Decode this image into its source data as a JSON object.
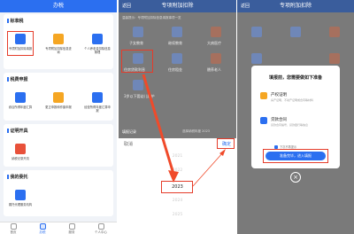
{
  "p1": {
    "title": "办税",
    "sec1": "标准税",
    "items1": [
      "专项附加扣除填报",
      "专项附加扣除信息查询",
      "个人养老金扣除信息管理"
    ],
    "sec2": "税费申报",
    "items2": [
      "综合所得年度汇算",
      "更正申报和作废申报",
      "经营所得年度汇算申报"
    ],
    "sec3": "证明开具",
    "items3": [
      "纳税记录开具"
    ],
    "sec4": "我的委托",
    "items4": [
      "委托代理服务机构"
    ],
    "tabs": [
      "首页",
      "办税",
      "服务",
      "个人中心"
    ]
  },
  "p2": {
    "back": "返回",
    "title": "专项附加扣除",
    "notice": "温馨提示：专项附加扣除信息填报事项一览",
    "row1": [
      "子女教育",
      "继续教育",
      "大病医疗"
    ],
    "row2": [
      "住房贷款利息",
      "住房租金",
      "赡养老人"
    ],
    "row3": "3岁以下婴幼儿照护",
    "records": "填报记录",
    "year_label": "选择纳税年度 2023",
    "cancel": "取消",
    "confirm": "确定",
    "years": [
      "2021",
      "2022",
      "2023",
      "2024",
      "2025"
    ]
  },
  "p3": {
    "back": "返回",
    "title": "专项附加扣除",
    "dialog_title": "填报前，您需要做如下准备",
    "i1_title": "产权证明",
    "i1_desc": "房产证明、不动产证明或合同等材料",
    "i2_title": "贷款合同",
    "i2_desc": "贷款合同编号、贷款银行等信息",
    "check": "下次不再提示",
    "cta": "准备完毕，进入填报"
  }
}
